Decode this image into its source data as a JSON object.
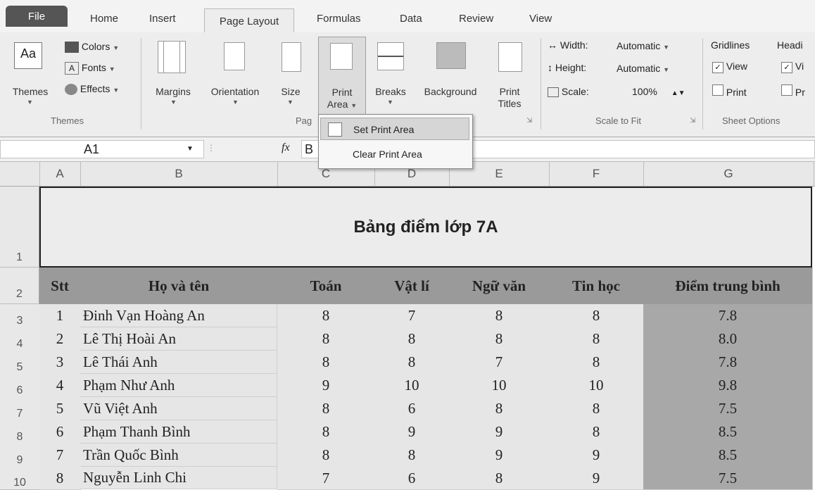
{
  "ribbon": {
    "tabs": [
      "File",
      "Home",
      "Insert",
      "Page Layout",
      "Formulas",
      "Data",
      "Review",
      "View"
    ],
    "themes_group": {
      "themes_label": "Themes",
      "colors_label": "Colors",
      "fonts_label": "Fonts",
      "effects_label": "Effects",
      "group_label": "Themes"
    },
    "page_setup": {
      "margins": "Margins",
      "orientation": "Orientation",
      "size": "Size",
      "print_area_1": "Print",
      "print_area_2": "Area",
      "breaks": "Breaks",
      "background": "Background",
      "print_titles_1": "Print",
      "print_titles_2": "Titles",
      "group_label_partial": "Pag"
    },
    "scale_to_fit": {
      "width_label": "Width:",
      "width_value": "Automatic",
      "height_label": "Height:",
      "height_value": "Automatic",
      "scale_label": "Scale:",
      "scale_value": "100%",
      "group_label": "Scale to Fit"
    },
    "sheet_options": {
      "gridlines": "Gridlines",
      "headings_partial": "Headi",
      "view": "View",
      "view_partial": "Vi",
      "print": "Print",
      "print_partial": "Pr",
      "group_label": "Sheet Options"
    },
    "print_area_menu": {
      "set": "Set Print Area",
      "clear": "Clear Print Area"
    }
  },
  "formula_bar": {
    "name_box": "A1",
    "fx": "fx",
    "content_partial": "B"
  },
  "sheet": {
    "columns": [
      "A",
      "B",
      "C",
      "D",
      "E",
      "F",
      "G"
    ],
    "title": "Bảng điểm lớp 7A",
    "headers": [
      "Stt",
      "Họ và tên",
      "Toán",
      "Vật lí",
      "Ngữ văn",
      "Tin học",
      "Điểm trung bình"
    ],
    "rows": [
      [
        "1",
        "Đinh Vạn Hoàng An",
        "8",
        "7",
        "8",
        "8",
        "7.8"
      ],
      [
        "2",
        "Lê Thị Hoài An",
        "8",
        "8",
        "8",
        "8",
        "8.0"
      ],
      [
        "3",
        "Lê Thái Anh",
        "8",
        "8",
        "7",
        "8",
        "7.8"
      ],
      [
        "4",
        "Phạm Như Anh",
        "9",
        "10",
        "10",
        "10",
        "9.8"
      ],
      [
        "5",
        "Vũ Việt Anh",
        "8",
        "6",
        "8",
        "8",
        "7.5"
      ],
      [
        "6",
        "Phạm Thanh Bình",
        "8",
        "9",
        "9",
        "8",
        "8.5"
      ],
      [
        "7",
        "Trần Quốc Bình",
        "8",
        "8",
        "9",
        "9",
        "8.5"
      ],
      [
        "8",
        "Nguyễn Linh Chi",
        "7",
        "6",
        "8",
        "9",
        "7.5"
      ]
    ],
    "row_numbers": [
      "1",
      "2",
      "3",
      "4",
      "5",
      "6",
      "7",
      "8",
      "9",
      "10"
    ]
  }
}
